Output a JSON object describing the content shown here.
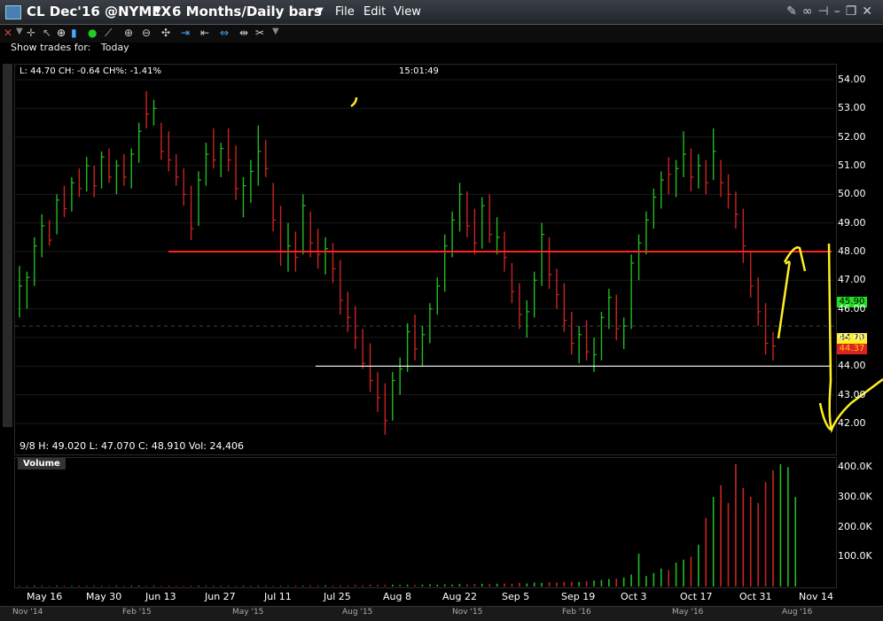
{
  "window": {
    "title": "CL Dec'16 @NYMEX",
    "period": "6 Months/Daily bars",
    "menu": [
      "File",
      "Edit",
      "View"
    ]
  },
  "toolbar": {
    "show_trades_label": "Show trades for:",
    "show_trades_value": "Today"
  },
  "info": {
    "last": "L: 44.70  CH: -0.64  CH%: -1.41%",
    "time": "15:01:49",
    "bottom": "9/8    H: 49.020    L: 47.070    C: 48.910    Vol: 24,406"
  },
  "volume_label": "Volume",
  "price_tags": {
    "green": "45.90",
    "yellow": "44.70",
    "red": "44.37"
  },
  "colors": {
    "up": "#22bb22",
    "down": "#cc2222",
    "red_line": "#ff2020",
    "white_line": "#ffffff",
    "annot": "#ffee22"
  },
  "chart_data": {
    "type": "bar",
    "price_axis": [
      "54.00",
      "53.00",
      "52.00",
      "51.00",
      "50.00",
      "49.00",
      "48.00",
      "47.00",
      "46.00",
      "45.00",
      "44.00",
      "43.00",
      "42.00"
    ],
    "volume_axis": [
      "400.0K",
      "300.0K",
      "200.0K",
      "100.0K"
    ],
    "x_labels": [
      "May 16",
      "May 30",
      "Jun 13",
      "Jun 27",
      "Jul 11",
      "Jul 25",
      "Aug 8",
      "Aug 22",
      "Sep 5",
      "Sep 19",
      "Oct 3",
      "Oct 17",
      "Oct 31",
      "Nov 14"
    ],
    "nav_labels": [
      "Nov '14",
      "Feb '15",
      "May '15",
      "Aug '15",
      "Nov '15",
      "Feb '16",
      "May '16",
      "Aug '16"
    ],
    "ylim": [
      41.5,
      54.5
    ],
    "vlim": [
      0,
      410
    ],
    "resistance": 48.0,
    "support": 44.0,
    "bars": [
      [
        47.5,
        45.7,
        46.8,
        1
      ],
      [
        47.3,
        46.0,
        47.1,
        1
      ],
      [
        48.5,
        46.8,
        48.2,
        1
      ],
      [
        49.3,
        47.8,
        48.9,
        1
      ],
      [
        49.1,
        48.2,
        48.4,
        0
      ],
      [
        50.0,
        48.6,
        49.8,
        1
      ],
      [
        50.3,
        49.2,
        49.5,
        0
      ],
      [
        50.6,
        49.4,
        50.4,
        1
      ],
      [
        50.9,
        49.9,
        50.2,
        0
      ],
      [
        51.3,
        50.1,
        51.0,
        1
      ],
      [
        51.0,
        49.9,
        50.3,
        0
      ],
      [
        51.5,
        50.2,
        51.3,
        1
      ],
      [
        51.6,
        50.4,
        50.6,
        0
      ],
      [
        51.2,
        50.0,
        51.0,
        1
      ],
      [
        51.4,
        50.3,
        50.6,
        0
      ],
      [
        51.6,
        50.2,
        51.4,
        1
      ],
      [
        52.5,
        51.1,
        52.2,
        1
      ],
      [
        53.6,
        52.3,
        52.8,
        0
      ],
      [
        53.3,
        52.4,
        53.0,
        1
      ],
      [
        52.5,
        51.2,
        51.5,
        0
      ],
      [
        52.2,
        50.8,
        51.2,
        0
      ],
      [
        51.4,
        50.3,
        50.6,
        0
      ],
      [
        50.9,
        49.6,
        50.0,
        0
      ],
      [
        50.3,
        48.4,
        48.8,
        0
      ],
      [
        50.8,
        48.9,
        50.5,
        1
      ],
      [
        51.8,
        50.3,
        51.4,
        1
      ],
      [
        52.3,
        50.9,
        51.2,
        0
      ],
      [
        51.8,
        50.6,
        51.6,
        1
      ],
      [
        52.3,
        50.8,
        51.2,
        0
      ],
      [
        51.7,
        49.8,
        50.2,
        0
      ],
      [
        50.6,
        49.2,
        50.3,
        1
      ],
      [
        51.2,
        49.7,
        50.8,
        1
      ],
      [
        52.4,
        50.3,
        51.5,
        1
      ],
      [
        51.9,
        50.6,
        50.9,
        0
      ],
      [
        50.4,
        48.7,
        49.1,
        0
      ],
      [
        49.6,
        47.5,
        48.0,
        0
      ],
      [
        49.0,
        47.3,
        48.2,
        1
      ],
      [
        48.7,
        47.3,
        47.8,
        0
      ],
      [
        50.0,
        47.9,
        49.6,
        1
      ],
      [
        49.4,
        47.8,
        48.3,
        0
      ],
      [
        48.8,
        47.4,
        47.9,
        0
      ],
      [
        48.5,
        47.2,
        48.1,
        1
      ],
      [
        48.3,
        46.9,
        47.4,
        0
      ],
      [
        47.7,
        45.8,
        46.3,
        0
      ],
      [
        46.6,
        45.2,
        45.7,
        0
      ],
      [
        46.1,
        44.6,
        45.0,
        0
      ],
      [
        45.3,
        43.9,
        44.1,
        0
      ],
      [
        44.8,
        43.1,
        43.5,
        0
      ],
      [
        43.8,
        42.4,
        42.9,
        0
      ],
      [
        43.4,
        41.6,
        42.1,
        0
      ],
      [
        43.8,
        42.1,
        43.5,
        1
      ],
      [
        44.3,
        43.0,
        43.9,
        1
      ],
      [
        45.5,
        43.8,
        45.2,
        1
      ],
      [
        45.8,
        44.2,
        44.6,
        0
      ],
      [
        45.4,
        44.0,
        45.1,
        1
      ],
      [
        46.2,
        44.8,
        46.0,
        1
      ],
      [
        47.1,
        45.8,
        46.8,
        1
      ],
      [
        48.6,
        46.6,
        48.2,
        1
      ],
      [
        49.4,
        47.8,
        49.1,
        1
      ],
      [
        50.4,
        48.7,
        50.0,
        1
      ],
      [
        50.1,
        48.5,
        48.9,
        0
      ],
      [
        49.5,
        47.9,
        48.3,
        0
      ],
      [
        49.9,
        48.1,
        49.6,
        1
      ],
      [
        50.0,
        48.3,
        48.6,
        0
      ],
      [
        49.2,
        47.9,
        48.5,
        1
      ],
      [
        48.7,
        47.3,
        47.8,
        0
      ],
      [
        47.6,
        46.2,
        46.6,
        0
      ],
      [
        46.9,
        45.3,
        45.8,
        0
      ],
      [
        46.3,
        45.0,
        45.9,
        1
      ],
      [
        47.3,
        45.7,
        47.0,
        1
      ],
      [
        49.0,
        46.8,
        48.6,
        1
      ],
      [
        48.5,
        46.7,
        47.2,
        0
      ],
      [
        47.4,
        46.0,
        46.5,
        0
      ],
      [
        46.9,
        45.2,
        45.6,
        0
      ],
      [
        45.9,
        44.4,
        44.8,
        0
      ],
      [
        45.4,
        44.1,
        45.1,
        1
      ],
      [
        45.6,
        44.2,
        44.5,
        0
      ],
      [
        45.0,
        43.8,
        44.4,
        1
      ],
      [
        45.9,
        44.2,
        45.7,
        1
      ],
      [
        46.7,
        45.3,
        46.4,
        1
      ],
      [
        46.5,
        44.9,
        45.3,
        0
      ],
      [
        45.7,
        44.6,
        45.4,
        1
      ],
      [
        47.9,
        45.3,
        47.6,
        1
      ],
      [
        48.6,
        47.0,
        48.3,
        1
      ],
      [
        49.4,
        47.9,
        49.1,
        1
      ],
      [
        50.2,
        48.8,
        49.9,
        1
      ],
      [
        50.8,
        49.5,
        50.5,
        1
      ],
      [
        51.3,
        50.0,
        50.7,
        0
      ],
      [
        51.2,
        49.9,
        50.9,
        1
      ],
      [
        52.2,
        50.6,
        51.4,
        1
      ],
      [
        51.6,
        50.1,
        50.6,
        0
      ],
      [
        51.4,
        50.2,
        51.0,
        1
      ],
      [
        51.2,
        50.0,
        50.4,
        0
      ],
      [
        52.3,
        50.5,
        51.5,
        1
      ],
      [
        51.2,
        49.9,
        50.4,
        0
      ],
      [
        50.7,
        49.5,
        50.0,
        0
      ],
      [
        50.1,
        48.8,
        49.3,
        0
      ],
      [
        49.5,
        47.6,
        48.2,
        0
      ],
      [
        48.0,
        46.4,
        46.8,
        0
      ],
      [
        47.1,
        45.4,
        45.9,
        0
      ],
      [
        46.2,
        44.4,
        44.8,
        0
      ],
      [
        45.2,
        44.2,
        44.7,
        0
      ]
    ],
    "volumes": [
      2,
      2,
      3,
      2,
      2,
      3,
      2,
      2,
      3,
      2,
      3,
      2,
      2,
      3,
      2,
      3,
      3,
      2,
      3,
      2,
      3,
      2,
      2,
      3,
      3,
      2,
      3,
      2,
      3,
      2,
      3,
      2,
      3,
      3,
      2,
      3,
      2,
      3,
      3,
      4,
      3,
      4,
      3,
      4,
      3,
      5,
      4,
      6,
      5,
      5,
      6,
      5,
      6,
      5,
      6,
      7,
      6,
      7,
      6,
      8,
      7,
      8,
      9,
      8,
      9,
      10,
      9,
      12,
      10,
      13,
      12,
      14,
      13,
      15,
      16,
      15,
      18,
      20,
      22,
      25,
      26,
      30,
      40,
      110,
      35,
      45,
      60,
      55,
      80,
      90,
      100,
      140,
      230,
      300,
      340,
      280,
      410,
      330,
      300,
      280,
      350,
      390,
      410,
      400,
      300
    ]
  }
}
